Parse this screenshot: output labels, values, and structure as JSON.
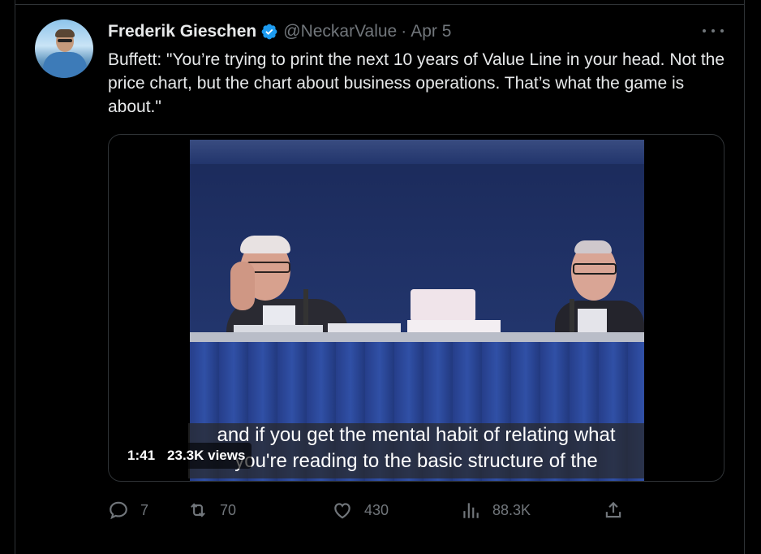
{
  "tweet": {
    "author_name": "Frederik Gieschen",
    "handle": "@NeckarValue",
    "separator": "·",
    "date": "Apr 5",
    "text": "Buffett: \"You’re trying to print the next 10 years of Value Line in your head. Not the price chart, but the chart about business operations. That’s what the game is about.\""
  },
  "video": {
    "caption_line1": "and if you get the mental habit of relating what",
    "caption_line2": "you're reading to the basic structure of the",
    "duration": "1:41",
    "views": "23.3K views"
  },
  "actions": {
    "replies": "7",
    "reposts": "70",
    "likes": "430",
    "views": "88.3K"
  },
  "icons": {
    "verified": "verified-badge-icon",
    "more": "more-icon",
    "reply": "reply-icon",
    "repost": "repost-icon",
    "like": "heart-icon",
    "views": "analytics-icon",
    "share": "share-icon"
  },
  "colors": {
    "background": "#000000",
    "text_primary": "#e7e9ea",
    "text_secondary": "#71767b",
    "verified_blue": "#1d9bf0",
    "border": "#2f3336"
  }
}
